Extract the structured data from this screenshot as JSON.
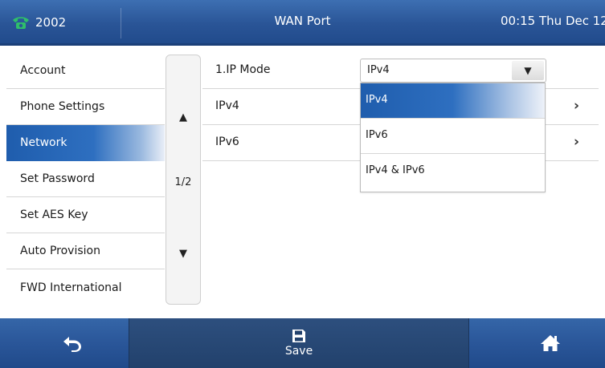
{
  "status_bar": {
    "account": "2002",
    "title": "WAN Port",
    "clock": "00:15 Thu Dec 12"
  },
  "sidebar": {
    "items": [
      {
        "label": "Account",
        "active": false
      },
      {
        "label": "Phone Settings",
        "active": false
      },
      {
        "label": "Network",
        "active": true
      },
      {
        "label": "Set Password",
        "active": false
      },
      {
        "label": "Set AES Key",
        "active": false
      },
      {
        "label": "Auto Provision",
        "active": false
      },
      {
        "label": "FWD International",
        "active": false
      }
    ]
  },
  "pager": {
    "up_arrow": "▲",
    "page_indicator": "1/2",
    "down_arrow": "▼"
  },
  "settings": {
    "ip_mode_label": "1.IP Mode",
    "ip_mode_value": "IPv4",
    "dropdown_arrow": "▼",
    "rows": [
      {
        "label": "IPv4",
        "chevron": "›"
      },
      {
        "label": "IPv6",
        "chevron": "›"
      }
    ]
  },
  "dropdown": {
    "options": [
      {
        "label": "IPv4",
        "selected": true
      },
      {
        "label": "IPv6",
        "selected": false
      },
      {
        "label": "IPv4 & IPv6",
        "selected": false
      }
    ]
  },
  "softkeys": {
    "back_icon": "back-arrow-icon",
    "save_label": "Save",
    "save_icon": "floppy-disk-icon",
    "home_icon": "home-icon"
  },
  "colors": {
    "accent": "#2a5597",
    "phone_icon": "#2fbf6a",
    "highlight": "#1f5dad"
  }
}
